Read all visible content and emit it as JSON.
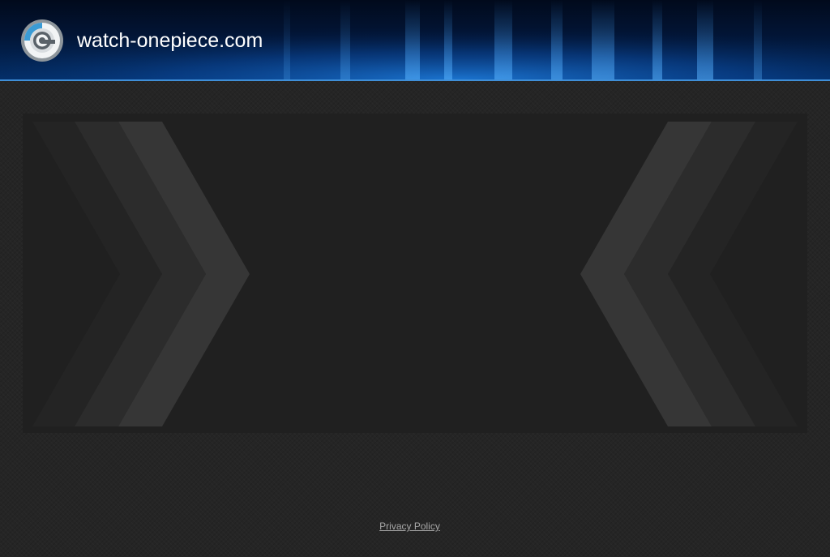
{
  "header": {
    "logo_icon": "rotating-ring-logo-icon",
    "site_title": "watch-onepiece.com",
    "accent_color": "#3a9bd5"
  },
  "main": {
    "left_decoration_icon": "chevron-right-stripes-icon",
    "right_decoration_icon": "chevron-left-stripes-icon"
  },
  "footer": {
    "privacy_link_label": "Privacy Policy"
  }
}
